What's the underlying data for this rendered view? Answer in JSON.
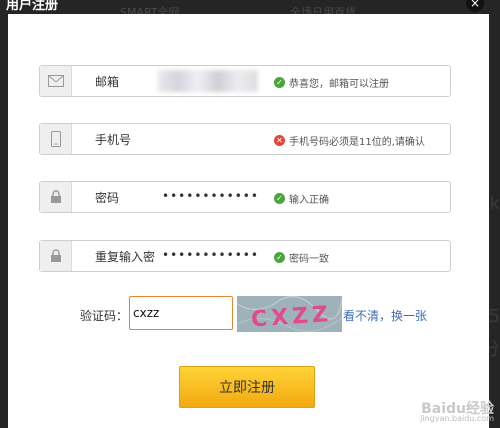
{
  "dialog": {
    "title": "用户注册",
    "close_glyph": "×"
  },
  "background": {
    "fragment_1": "SMART全网",
    "fragment_2": "全场日用百货",
    "right_glyph_1": "k",
    "right_glyph_2": "5",
    "right_glyph_3": "分"
  },
  "fields": [
    {
      "label": "邮箱",
      "icon": "envelope-icon",
      "value": "",
      "value_blurred": true,
      "status": "ok",
      "message": "恭喜您，邮箱可以注册"
    },
    {
      "label": "手机号",
      "icon": "phone-icon",
      "value": "",
      "status": "error",
      "message": "手机号码必须是11位的,请确认"
    },
    {
      "label": "密码",
      "icon": "lock-icon",
      "value": "••••••••••••",
      "status": "ok",
      "message": "输入正确"
    },
    {
      "label": "重复输入密",
      "icon": "lock-icon",
      "value": "••••••••••••",
      "status": "ok",
      "message": "密码一致"
    }
  ],
  "captcha": {
    "label": "验证码：",
    "input_value": "cxzz",
    "image_text": "CXZZ",
    "refresh_link": "看不清，换一张"
  },
  "submit": {
    "label": "立即注册"
  },
  "watermark": {
    "brand": "Baidu经验",
    "url": "jingyan.baidu.com"
  },
  "colors": {
    "ok": "#4aa63b",
    "error": "#e2463a",
    "button": "#f2b21b",
    "link": "#3b6fb6"
  }
}
